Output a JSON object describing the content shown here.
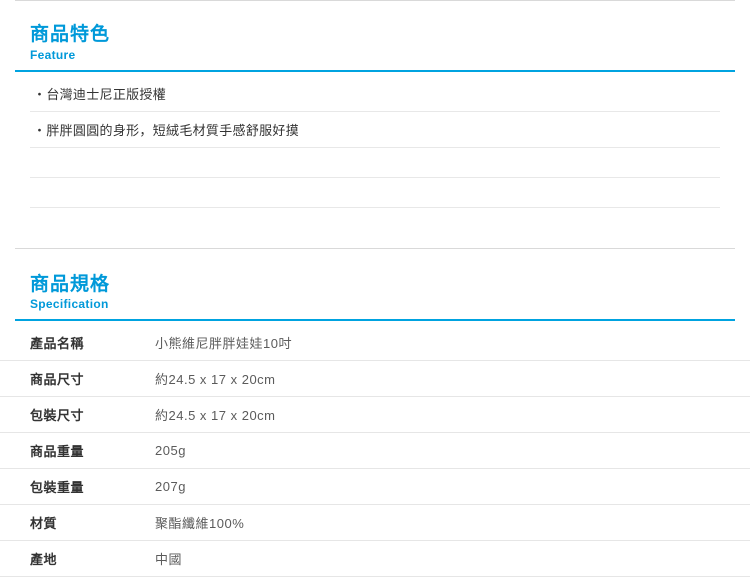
{
  "feature": {
    "title_cn": "商品特色",
    "title_en": "Feature",
    "items": [
      "台灣迪士尼正版授權",
      "胖胖圓圓的身形，短絨毛材質手感舒服好摸"
    ]
  },
  "spec": {
    "title_cn": "商品規格",
    "title_en": "Specification",
    "rows": [
      {
        "label": "產品名稱",
        "value": "小熊維尼胖胖娃娃10吋"
      },
      {
        "label": "商品尺寸",
        "value": "約24.5 x 17 x 20cm"
      },
      {
        "label": "包裝尺寸",
        "value": "約24.5 x 17 x 20cm"
      },
      {
        "label": "商品重量",
        "value": "205g"
      },
      {
        "label": "包裝重量",
        "value": "207g"
      },
      {
        "label": "材質",
        "value": "聚酯纖維100%"
      },
      {
        "label": "產地",
        "value": "中國"
      }
    ]
  }
}
